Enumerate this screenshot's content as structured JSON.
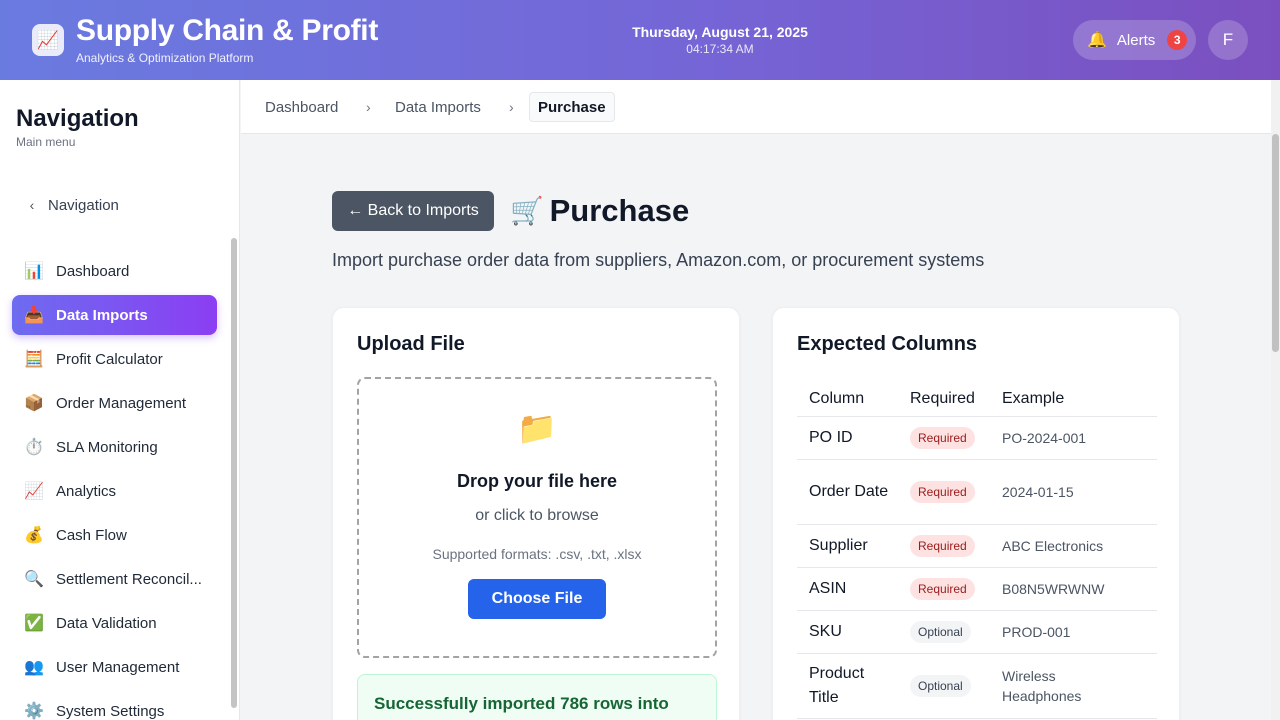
{
  "header": {
    "app_icon": "chart-up-icon",
    "app_title": "Supply Chain & Profit",
    "app_subtitle": "Analytics & Optimization Platform",
    "date": "Thursday, August 21, 2025",
    "time": "04:17:34 AM",
    "alerts_label": "Alerts",
    "alerts_count": "3",
    "avatar_initial": "F",
    "gradient_start": "#6a7be0",
    "gradient_end": "#7b4fbf"
  },
  "sidebar": {
    "title": "Navigation",
    "subtitle": "Main menu",
    "back_label": "Navigation",
    "items": [
      {
        "icon": "📊",
        "label": "Dashboard"
      },
      {
        "icon": "📥",
        "label": "Data Imports"
      },
      {
        "icon": "🧮",
        "label": "Profit Calculator"
      },
      {
        "icon": "📦",
        "label": "Order Management"
      },
      {
        "icon": "⏱️",
        "label": "SLA Monitoring"
      },
      {
        "icon": "📈",
        "label": "Analytics"
      },
      {
        "icon": "💰",
        "label": "Cash Flow"
      },
      {
        "icon": "🔍",
        "label": "Settlement Reconcil..."
      },
      {
        "icon": "✅",
        "label": "Data Validation"
      },
      {
        "icon": "👥",
        "label": "User Management"
      },
      {
        "icon": "⚙️",
        "label": "System Settings"
      }
    ],
    "active_index": 1,
    "active_color": "#8b3ef2"
  },
  "breadcrumb": {
    "items": [
      "Dashboard",
      "Data Imports"
    ],
    "current": "Purchase"
  },
  "page": {
    "back_button": "← Back to Imports",
    "title_icon": "🛒",
    "title": "Purchase",
    "description": "Import purchase order data from suppliers, Amazon.com, or procurement systems"
  },
  "upload": {
    "title": "Upload File",
    "dropzone_icon": "📁",
    "dropzone_title": "Drop your file here",
    "dropzone_sub": "or click to browse",
    "formats": "Supported formats: .csv, .txt, .xlsx",
    "choose_button": "Choose File",
    "success_message": "Successfully imported 786 rows into",
    "accent": "#2563eb"
  },
  "columns": {
    "title": "Expected Columns",
    "headers": [
      "Column",
      "Required",
      "Example"
    ],
    "rows": [
      {
        "name": "PO ID",
        "status": "Required",
        "example": "PO-2024-001"
      },
      {
        "name": "Order Date",
        "status": "Required",
        "example": "2024-01-15"
      },
      {
        "name": "Supplier",
        "status": "Required",
        "example": "ABC Electronics"
      },
      {
        "name": "ASIN",
        "status": "Required",
        "example": "B08N5WRWNW"
      },
      {
        "name": "SKU",
        "status": "Optional",
        "example": "PROD-001"
      },
      {
        "name": "Product Title",
        "status": "Optional",
        "example": "Wireless Headphones"
      }
    ]
  }
}
